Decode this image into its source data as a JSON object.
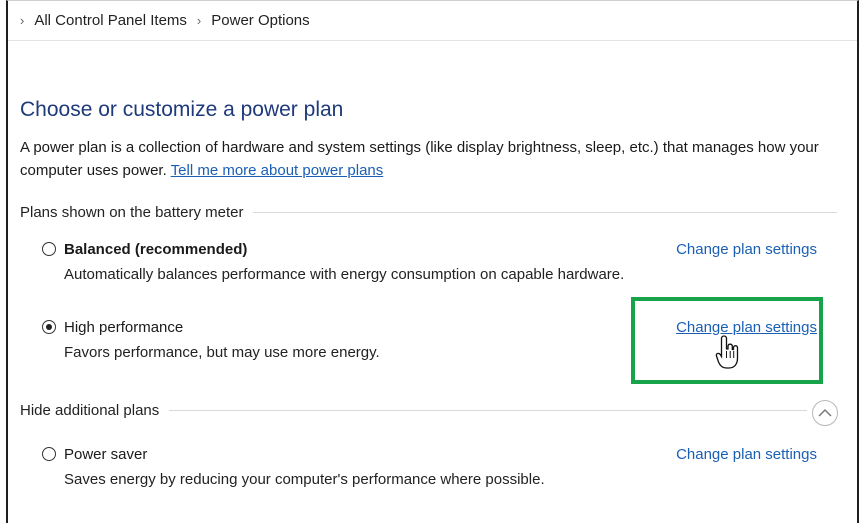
{
  "breadcrumb": {
    "items": [
      "All Control Panel Items",
      "Power Options"
    ]
  },
  "page": {
    "title": "Choose or customize a power plan",
    "description": "A power plan is a collection of hardware and system settings (like display brightness, sleep, etc.) that manages how your computer uses power.",
    "more_link": "Tell me more about power plans"
  },
  "sections": {
    "battery_meter": "Plans shown on the battery meter",
    "additional": "Hide additional plans"
  },
  "plans": [
    {
      "name": "Balanced (recommended)",
      "description": "Automatically balances performance with energy consumption on capable hardware.",
      "change_label": "Change plan settings",
      "selected": false
    },
    {
      "name": "High performance",
      "description": "Favors performance, but may use more energy.",
      "change_label": "Change plan settings",
      "selected": true
    },
    {
      "name": "Power saver",
      "description": "Saves energy by reducing your computer's performance where possible.",
      "change_label": "Change plan settings",
      "selected": false
    }
  ],
  "colors": {
    "title": "#1e3a7b",
    "link": "#1a5fb4",
    "highlight": "#16a34a"
  },
  "icons": {
    "breadcrumb_separator": "chevron-right-icon",
    "collapse": "chevron-up-icon",
    "cursor": "hand-pointer-icon"
  }
}
